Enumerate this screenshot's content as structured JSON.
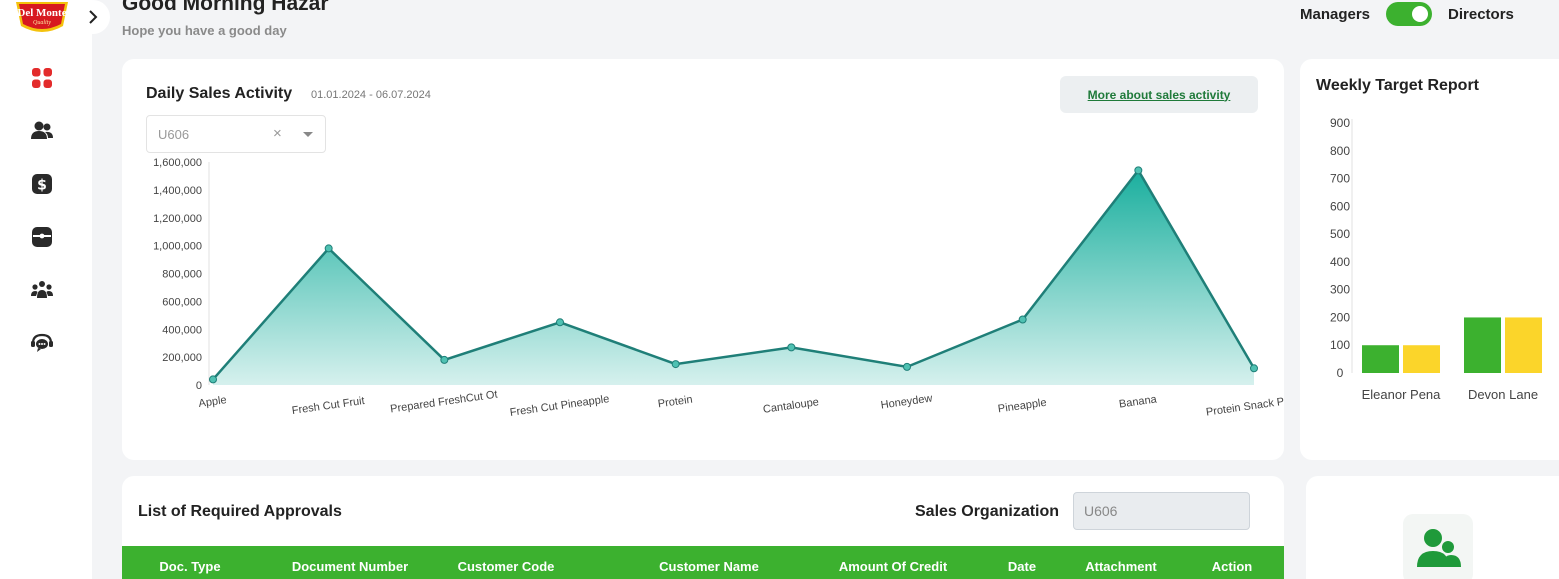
{
  "brand": {
    "logo_text": "Del Monte",
    "logo_subtext": "Quality"
  },
  "header": {
    "greeting": "Good Morning Hazar",
    "subtitle": "Hope you have a good day",
    "toggle_left_label": "Managers",
    "toggle_right_label": "Directors",
    "toggle_state": "on"
  },
  "sidebar": {
    "items": [
      {
        "icon": "dashboard-grid-icon",
        "active": true
      },
      {
        "icon": "users-icon"
      },
      {
        "icon": "dollar-icon"
      },
      {
        "icon": "inbox-icon"
      },
      {
        "icon": "team-icon"
      },
      {
        "icon": "support-chat-icon"
      }
    ]
  },
  "sales": {
    "title": "Daily Sales Activity",
    "date_range": "01.01.2024 - 06.07.2024",
    "more_label": "More about sales activity",
    "org_select_value": "U606",
    "clear_symbol": "×"
  },
  "weekly": {
    "title": "Weekly Target Report"
  },
  "approvals": {
    "title": "List of Required Approvals",
    "sales_org_label": "Sales Organization",
    "sales_org_value": "U606",
    "columns": [
      "Doc. Type",
      "Document Number",
      "Customer Code",
      "Customer Name",
      "Amount Of Credit",
      "Date",
      "Attachment",
      "Action"
    ]
  },
  "colors": {
    "accent_green": "#3cb12f",
    "area_teal": "#1aaf9e",
    "line_teal": "#1f7f78",
    "target_yellow": "#fbd52a"
  },
  "chart_data": [
    {
      "type": "area",
      "title": "Daily Sales Activity",
      "categories": [
        "Apple",
        "Fresh Cut Fruit",
        "Prepared FreshCut Ot",
        "Fresh Cut Pineapple",
        "Protein",
        "Cantaloupe",
        "Honeydew",
        "Pineapple",
        "Banana",
        "Protein Snack Pack"
      ],
      "values": [
        40000,
        980000,
        180000,
        450000,
        150000,
        270000,
        130000,
        470000,
        1540000,
        120000
      ],
      "ylim": [
        0,
        1600000
      ],
      "yticks": [
        0,
        200000,
        400000,
        600000,
        800000,
        1000000,
        1200000,
        1400000,
        1600000
      ],
      "ytick_labels": [
        "0",
        "200,000",
        "400,000",
        "600,000",
        "800,000",
        "1,000,000",
        "1,200,000",
        "1,400,000",
        "1,600,000"
      ],
      "grid": false
    },
    {
      "type": "bar",
      "title": "Weekly Target Report",
      "categories": [
        "Eleanor Pena",
        "Devon Lane"
      ],
      "series": [
        {
          "color": "#3cb12f",
          "values": [
            100,
            200
          ]
        },
        {
          "color": "#fbd52a",
          "values": [
            100,
            200
          ]
        }
      ],
      "ylim": [
        0,
        900
      ],
      "yticks": [
        0,
        100,
        200,
        300,
        400,
        500,
        600,
        700,
        800,
        900
      ],
      "grid": false
    }
  ]
}
